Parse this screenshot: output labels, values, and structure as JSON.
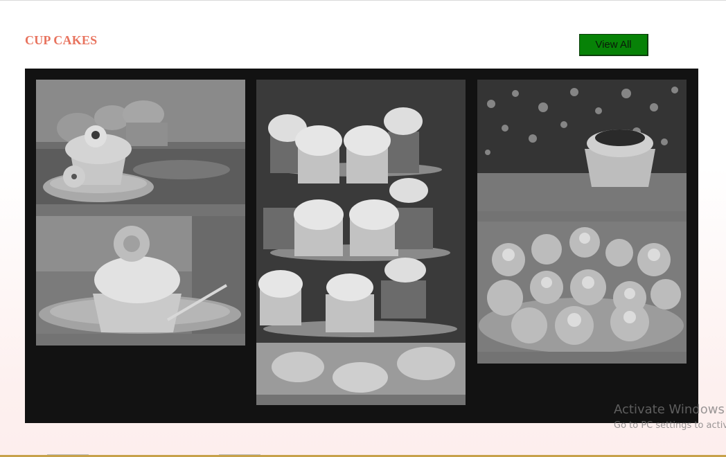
{
  "section": {
    "title": "CUP CAKES",
    "view_all_label": "View All"
  },
  "colors": {
    "title": "#e8735e",
    "button": "#078207",
    "gallery_bg": "#121212"
  },
  "gallery": {
    "photos": [
      {
        "subject": "cupcake with flower frosting on a plate"
      },
      {
        "subject": "cupcake with rose on a saucer with fork"
      },
      {
        "subject": "cupcakes on a tiered glass stand"
      },
      {
        "subject": "single cupcake with bokeh lights"
      },
      {
        "subject": "decorated floral cupcakes on a tray"
      }
    ]
  },
  "watermark": {
    "title": "Activate Windows",
    "subtitle": "Go to PC settings to activate Windows."
  }
}
